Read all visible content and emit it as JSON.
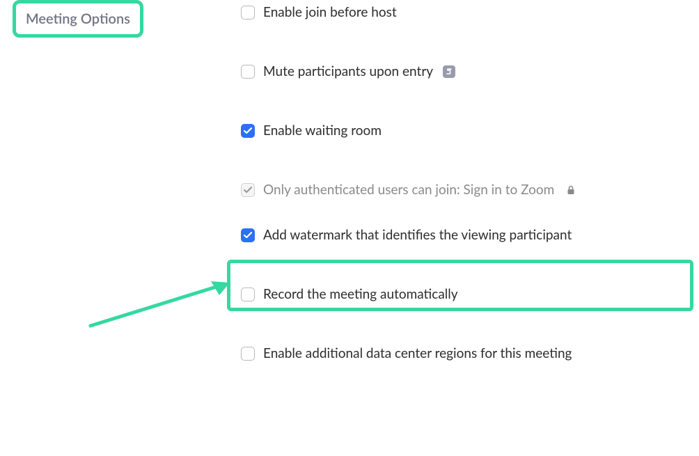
{
  "section": {
    "title": "Meeting Options"
  },
  "options": {
    "join_before_host": {
      "label": "Enable join before host",
      "checked": false
    },
    "mute_on_entry": {
      "label": "Mute participants upon entry",
      "checked": false
    },
    "waiting_room": {
      "label": "Enable waiting room",
      "checked": true
    },
    "authenticated": {
      "label": "Only authenticated users can join: Sign in to Zoom",
      "checked": true,
      "locked": true
    },
    "watermark": {
      "label": "Add watermark that identifies the viewing participant",
      "checked": true
    },
    "auto_record": {
      "label": "Record the meeting automatically",
      "checked": false
    },
    "data_center": {
      "label": "Enable additional data center regions for this meeting",
      "checked": false
    }
  },
  "annotation": {
    "highlight_color": "#35d8a1"
  }
}
